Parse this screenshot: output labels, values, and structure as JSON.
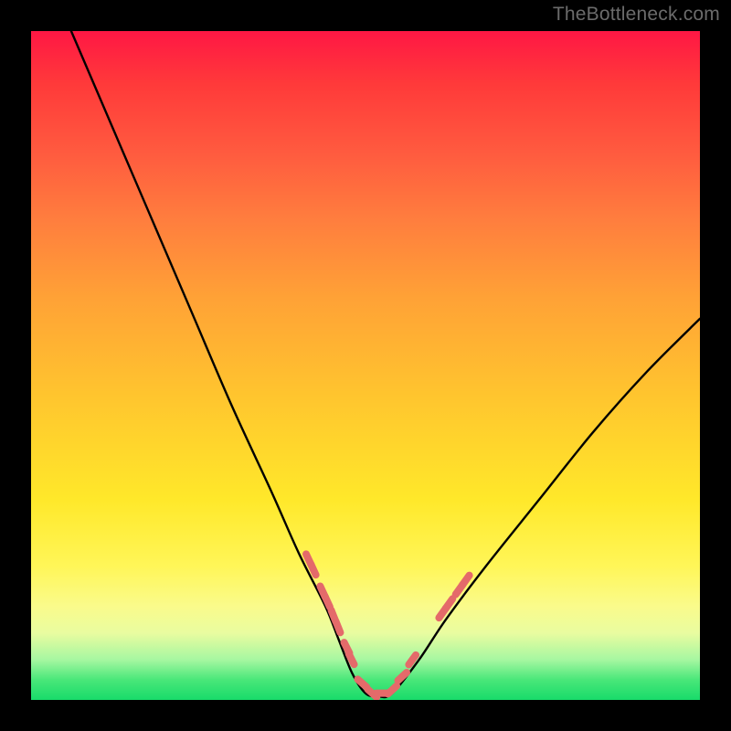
{
  "watermark": "TheBottleneck.com",
  "chart_data": {
    "type": "line",
    "title": "",
    "xlabel": "",
    "ylabel": "",
    "xlim": [
      0,
      100
    ],
    "ylim": [
      0,
      100
    ],
    "grid": false,
    "legend": false,
    "series": [
      {
        "name": "bottleneck-curve",
        "x": [
          6,
          12,
          18,
          24,
          30,
          36,
          40,
          44,
          46,
          48,
          50,
          52,
          54,
          58,
          62,
          68,
          76,
          84,
          92,
          100
        ],
        "y": [
          100,
          86,
          72,
          58,
          44,
          31,
          22,
          14,
          9,
          4,
          1,
          0.5,
          1,
          6,
          12,
          20,
          30,
          40,
          49,
          57
        ]
      }
    ],
    "markers": {
      "name": "highlight-dashes",
      "color": "#e46a6a",
      "points": [
        {
          "x": 41.5,
          "y": 21.0
        },
        {
          "x": 42.2,
          "y": 19.5
        },
        {
          "x": 43.6,
          "y": 16.2
        },
        {
          "x": 44.3,
          "y": 14.7
        },
        {
          "x": 45.2,
          "y": 12.6
        },
        {
          "x": 45.9,
          "y": 10.9
        },
        {
          "x": 47.2,
          "y": 7.8
        },
        {
          "x": 47.9,
          "y": 6.1
        },
        {
          "x": 49.5,
          "y": 2.5
        },
        {
          "x": 51.0,
          "y": 1.0
        },
        {
          "x": 52.5,
          "y": 1.0
        },
        {
          "x": 54.0,
          "y": 1.5
        },
        {
          "x": 55.5,
          "y": 3.5
        },
        {
          "x": 57.0,
          "y": 6.0
        },
        {
          "x": 61.5,
          "y": 13.0
        },
        {
          "x": 62.5,
          "y": 14.4
        },
        {
          "x": 64.0,
          "y": 16.5
        },
        {
          "x": 65.0,
          "y": 17.9
        }
      ]
    }
  }
}
